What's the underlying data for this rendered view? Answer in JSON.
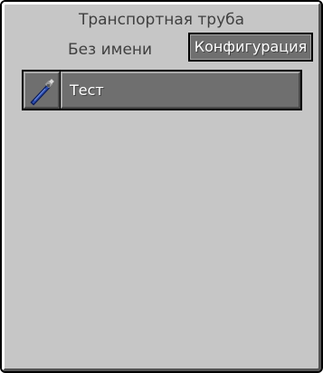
{
  "window": {
    "title": "Транспортная труба",
    "name_label": "Без имени"
  },
  "config_button": {
    "label": "Конфигурация"
  },
  "entries": [
    {
      "label": "Тест",
      "icon": "wrench-icon"
    }
  ],
  "colors": {
    "panel": "#c6c6c6",
    "button": "#6f6f6f",
    "border": "#000000",
    "text_dark": "#404040",
    "text_light": "#ffffff"
  }
}
